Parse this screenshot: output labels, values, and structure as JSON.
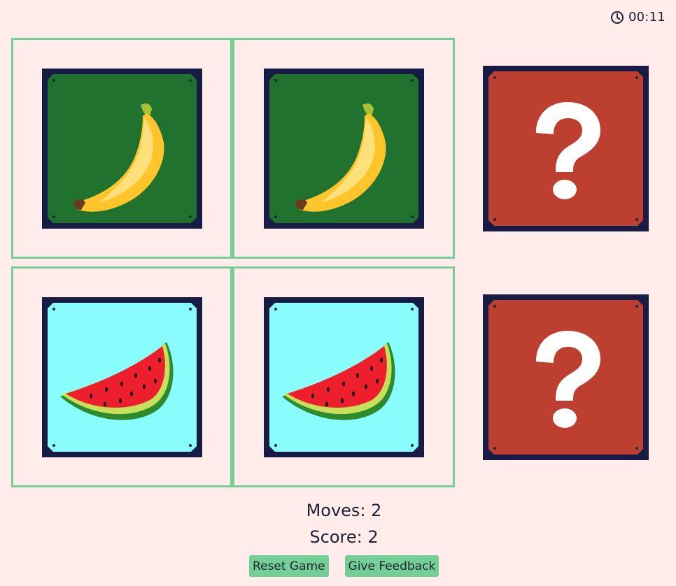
{
  "timer": {
    "icon": "clock-icon",
    "value": "00:11"
  },
  "board": {
    "cards": [
      {
        "state": "matched",
        "fruit": "banana",
        "face_color": "#22722f"
      },
      {
        "state": "matched",
        "fruit": "banana",
        "face_color": "#22722f"
      },
      {
        "state": "hidden",
        "icon": "question-mark-icon",
        "face_color": "#bd3f30"
      },
      {
        "state": "matched",
        "fruit": "watermelon",
        "face_color": "#89fdfd"
      },
      {
        "state": "matched",
        "fruit": "watermelon",
        "face_color": "#89fdfd"
      },
      {
        "state": "hidden",
        "icon": "question-mark-icon",
        "face_color": "#bd3f30"
      }
    ]
  },
  "stats": {
    "moves": "Moves: 2",
    "score": "Score: 2"
  },
  "buttons": {
    "reset": "Reset Game",
    "feedback": "Give Feedback"
  },
  "colors": {
    "background": "#ffeceb",
    "accent": "#74cf94",
    "card_border": "#171c44"
  }
}
